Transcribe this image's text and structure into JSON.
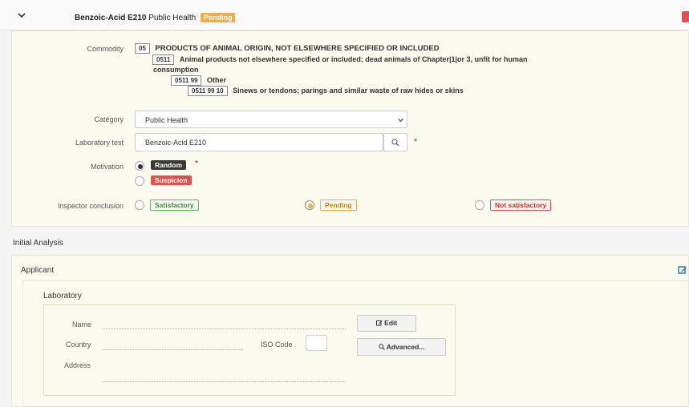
{
  "header": {
    "title_bold": "Benzoic-Acid E210",
    "title_rest": "Public Health",
    "status_badge": "Pending"
  },
  "commodity": {
    "label": "Commodity",
    "lines": [
      {
        "code": "05",
        "text": "PRODUCTS OF ANIMAL ORIGIN, NOT ELSEWHERE SPECIFIED OR INCLUDED"
      },
      {
        "code": "0511",
        "text": "Animal products not elsewhere specified or included; dead animals of Chapter|1|or 3, unfit for human",
        "text2": "consumption"
      },
      {
        "code": "0511 99",
        "text": "Other"
      },
      {
        "code": "0511 99 10",
        "text": "Sinews or tendons; parings and similar waste of raw hides or skins"
      }
    ]
  },
  "category": {
    "label": "Category",
    "value": "Public Health"
  },
  "laboratory_test": {
    "label": "Laboratory test",
    "value": "Benzoic-Acid E210",
    "required_mark": "*"
  },
  "motivation": {
    "label": "Motivation",
    "options": [
      "Random",
      "Suspicion"
    ],
    "selected": "Random",
    "required_mark": "*"
  },
  "inspector_conclusion": {
    "label": "Inspector conclusion",
    "options": [
      "Satisfactory",
      "Pending",
      "Not satisfactory"
    ],
    "selected": "Pending"
  },
  "initial_analysis": {
    "title": "Initial Analysis"
  },
  "applicant": {
    "title": "Applicant"
  },
  "laboratory": {
    "title": "Laboratory",
    "name_label": "Name",
    "country_label": "Country",
    "iso_label": "ISO Code",
    "address_label": "Address",
    "edit_button": "Edit",
    "advanced_button": "Advanced..."
  },
  "icons": {
    "header_toggle": "chevron-down-icon",
    "search": "search-icon",
    "select": "chevron-down-icon",
    "applicant_edit": "edit-icon",
    "edit_btn": "edit-icon",
    "advanced_btn": "search-icon"
  },
  "colors": {
    "pending": "#f0ad4e",
    "danger": "#d9534f",
    "success": "#5cb85c",
    "panel": "#fbfaee",
    "link_blue": "#337ab7"
  }
}
